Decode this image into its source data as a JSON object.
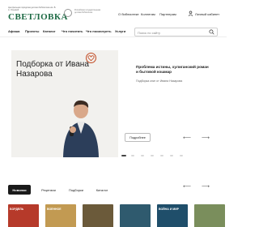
{
  "header": {
    "logo_small": "Центральная городская детская библиотека им. В. А. Осеевой",
    "logo": "СВЕТЛОВКА",
    "library_text": "Российская государственная детская библиотека",
    "links": [
      "О библиотеке",
      "Коллегам",
      "Партнерам"
    ],
    "account_label": "Личный кабинет"
  },
  "nav": {
    "items": [
      "Афиша",
      "Проекты",
      "Каталог",
      "Что почитать",
      "Что посмотреть",
      "Услуги"
    ],
    "search_placeholder": "Поиск по сайту"
  },
  "hero": {
    "title": "Подборка от Ивана Назарова",
    "headline": "Проблема истины, хулиганский роман и бытовой кошмар",
    "subtitle": "Подборка книг от Ивана Назарова",
    "more_label": "Подробнее",
    "prev": "⟵",
    "next": "⟶",
    "slide_count": 7,
    "active_slide": 0
  },
  "books_section": {
    "tabs": [
      "Новинки",
      "Рецензии",
      "Подборки",
      "Каталог"
    ],
    "active_tab": 0,
    "prev": "⟵",
    "next": "⟶",
    "books": [
      {
        "title": "БОРДЕЛЬ",
        "color": "#b63a2a"
      },
      {
        "title": "ВОЕННОЕ",
        "color": "#c29a52"
      },
      {
        "title": "",
        "color": "#6b5a3a"
      },
      {
        "title": "",
        "color": "#2f5a6e"
      },
      {
        "title": "ВОЙНА И МИР",
        "color": "#1f4e6a"
      },
      {
        "title": "",
        "color": "#7a8e5c"
      }
    ]
  },
  "colors": {
    "brand": "#1d6a44",
    "accent": "#c24a22"
  }
}
